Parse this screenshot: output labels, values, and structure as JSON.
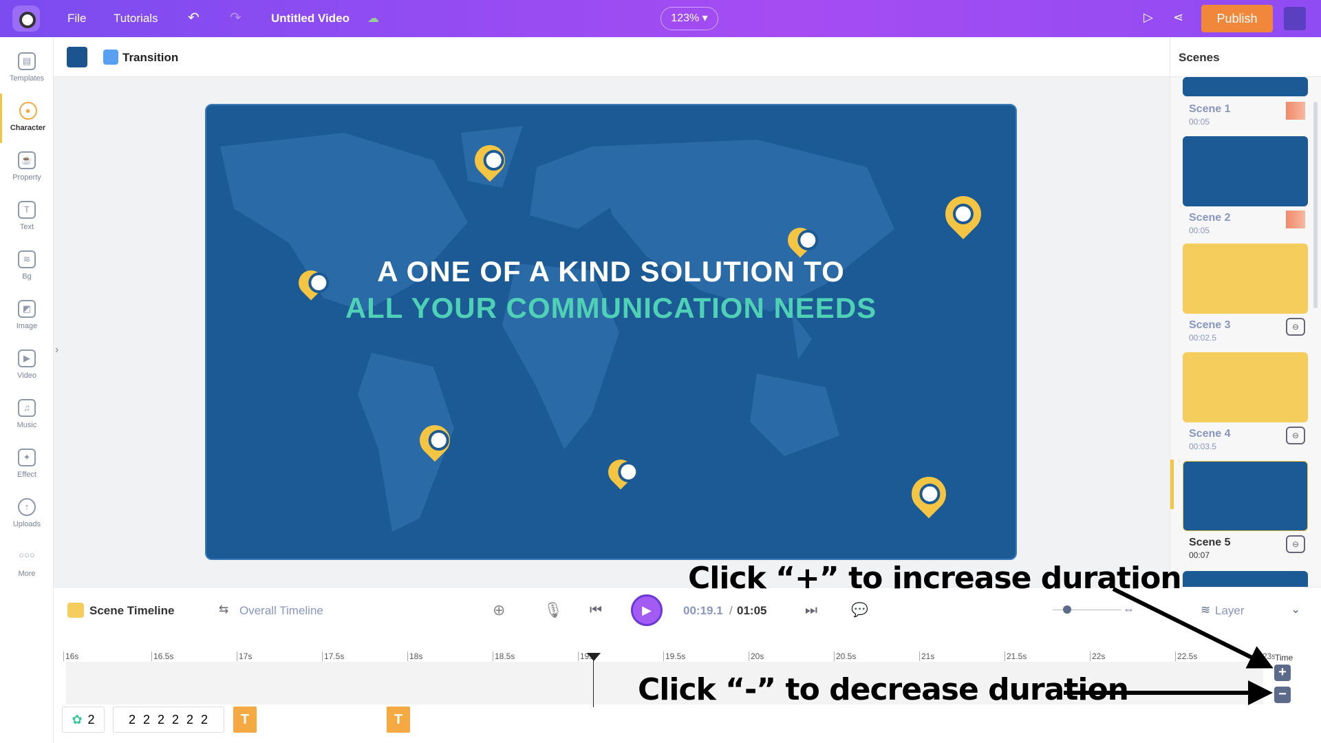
{
  "topbar": {
    "file": "File",
    "tutorials": "Tutorials",
    "title": "Untitled Video",
    "zoom": "123%",
    "publish": "Publish"
  },
  "sidebar": {
    "items": [
      {
        "label": "Templates",
        "icon": "templates-icon"
      },
      {
        "label": "Character",
        "icon": "character-icon"
      },
      {
        "label": "Property",
        "icon": "property-icon"
      },
      {
        "label": "Text",
        "icon": "text-icon"
      },
      {
        "label": "Bg",
        "icon": "background-icon"
      },
      {
        "label": "Image",
        "icon": "image-icon"
      },
      {
        "label": "Video",
        "icon": "video-icon"
      },
      {
        "label": "Music",
        "icon": "music-icon"
      },
      {
        "label": "Effect",
        "icon": "effect-icon"
      },
      {
        "label": "Uploads",
        "icon": "uploads-icon"
      },
      {
        "label": "More",
        "icon": "more-icon"
      }
    ],
    "active": "Character"
  },
  "toolbar": {
    "transition": "Transition",
    "bg_color": "#1a5590"
  },
  "canvas": {
    "line1": "A ONE OF A KIND SOLUTION TO",
    "line2": "ALL YOUR COMMUNICATION NEEDS",
    "line1_color": "#ffffff",
    "line2_color": "#4fd1b5",
    "bg": "#1b5a94"
  },
  "scenes": {
    "title": "Scenes",
    "items": [
      {
        "name": "Scene 1",
        "duration": "00:05",
        "color": "#1b5a94"
      },
      {
        "name": "Scene 2",
        "duration": "00:05",
        "color": "#1b5a94"
      },
      {
        "name": "Scene 3",
        "duration": "00:02.5",
        "color": "#f4cd5c"
      },
      {
        "name": "Scene 4",
        "duration": "00:03.5",
        "color": "#f4cd5c"
      },
      {
        "name": "Scene 5",
        "duration": "00:07",
        "color": "#1b5a94"
      }
    ],
    "active": "Scene 5"
  },
  "timeline": {
    "scene_tab": "Scene Timeline",
    "overall_tab": "Overall Timeline",
    "current": "00:19.1",
    "total": "01:05",
    "layer": "Layer",
    "time_label": "Time",
    "ticks": [
      "16s",
      "16.5s",
      "17s",
      "17.5s",
      "18s",
      "18.5s",
      "19s",
      "19.5s",
      "20s",
      "20.5s",
      "21s",
      "21.5s",
      "22s",
      "22.5s",
      "23s"
    ],
    "chips": [
      "2",
      "2",
      "2",
      "2",
      "2",
      "2",
      "2"
    ],
    "text_chip": "T",
    "plus": "+",
    "minus": "−"
  },
  "annotations": {
    "increase": "Click “+” to increase duration",
    "decrease": "Click “-” to decrease duration"
  }
}
